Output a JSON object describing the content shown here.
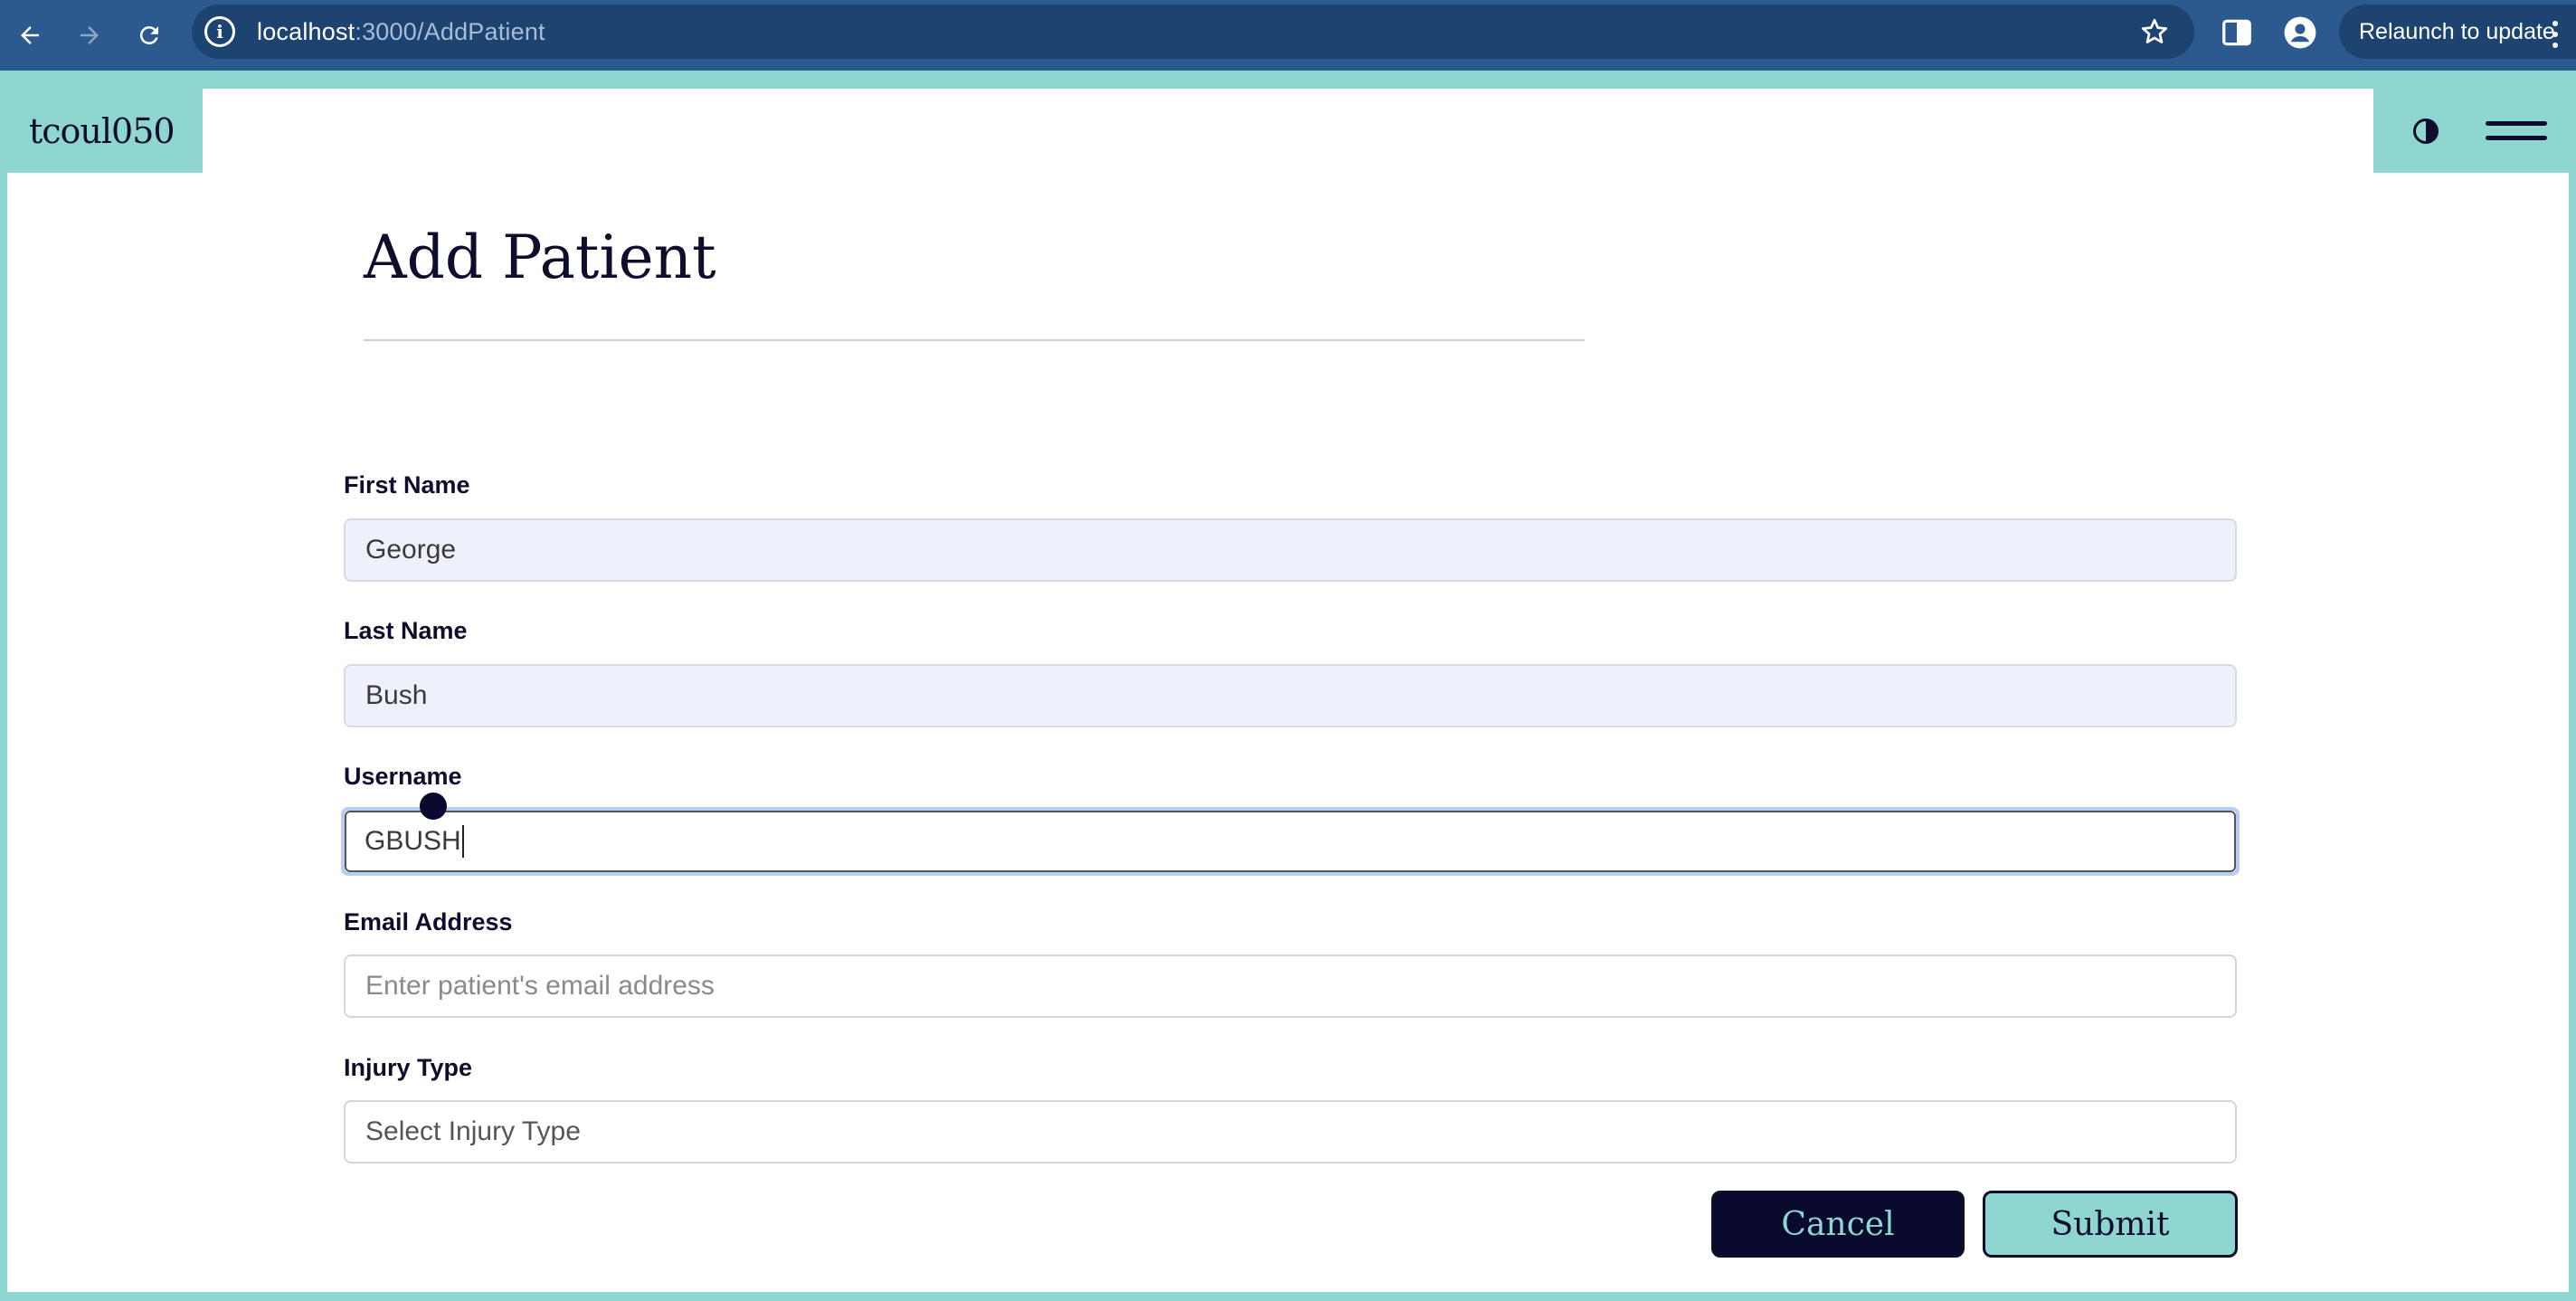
{
  "browser": {
    "url_host": "localhost",
    "url_path": ":3000/AddPatient",
    "relaunch_label": "Relaunch to update",
    "icons": [
      "back-icon",
      "forward-icon",
      "reload-icon",
      "info-icon",
      "star-icon",
      "side-panel-icon",
      "profile-icon",
      "kebab-menu-icon"
    ]
  },
  "app": {
    "brand": "tcoul050",
    "icons": [
      "contrast-icon",
      "hamburger-menu-icon"
    ],
    "colors": {
      "accent": "#8fd6d1",
      "dark": "#0a0a2e",
      "field_filled": "#eef1fb"
    }
  },
  "form": {
    "title": "Add Patient",
    "fields": [
      {
        "label": "First Name",
        "value": "George",
        "placeholder": ""
      },
      {
        "label": "Last Name",
        "value": "Bush",
        "placeholder": ""
      },
      {
        "label": "Username",
        "value": "GBUSH",
        "placeholder": ""
      },
      {
        "label": "Email Address",
        "value": "",
        "placeholder": "Enter patient's email address"
      },
      {
        "label": "Injury Type",
        "value": "",
        "placeholder": "Select Injury Type"
      }
    ],
    "cancel_label": "Cancel",
    "submit_label": "Submit"
  }
}
